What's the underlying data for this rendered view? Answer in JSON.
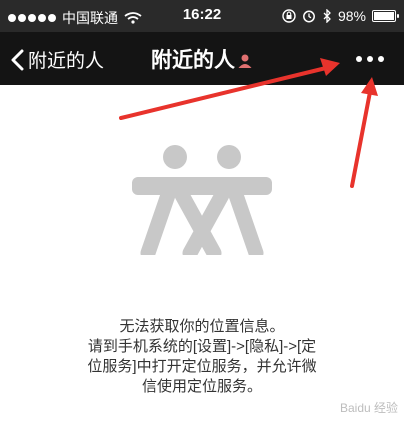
{
  "status_bar": {
    "carrier": "中国联通",
    "time": "16:22",
    "battery_text": "98%",
    "battery_level": 0.98,
    "icons": [
      "signal-dots-icon",
      "wifi-icon",
      "rotation-lock-icon",
      "alarm-icon",
      "bluetooth-icon",
      "battery-icon"
    ]
  },
  "nav": {
    "back_label": "附近的人",
    "title": "附近的人",
    "title_icon": "person-red-icon",
    "more_icon": "more-dots-icon"
  },
  "empty_state": {
    "illustration_icon": "two-people-icon",
    "message_lines": [
      "无法获取你的位置信息。",
      "请到手机系统的[设置]->[隐私]->[定",
      "位服务]中打开定位服务，并允许微",
      "信使用定位服务。"
    ]
  },
  "watermark": "Baidu 经验",
  "colors": {
    "status_bar_bg": "#2a2a2a",
    "nav_bg": "#141414",
    "illustration": "#c8c8c8",
    "arrow": "#e8332c",
    "text": "#333333"
  }
}
